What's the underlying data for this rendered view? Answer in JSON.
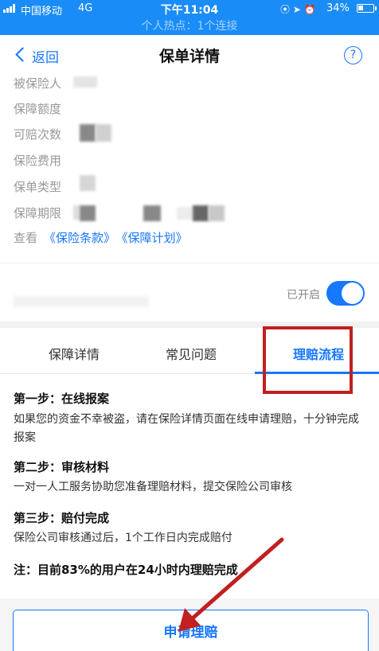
{
  "status_bar": {
    "carrier": "中国移动",
    "network": "4G",
    "time": "下午11:04",
    "battery": "34%",
    "battery_level": 0.34,
    "hotspot": "个人热点：1个连接"
  },
  "header": {
    "back_label": "返回",
    "title": "保单详情",
    "help_glyph": "?"
  },
  "policy_info": {
    "rows": [
      {
        "label": "被保险人"
      },
      {
        "label": "保障额度"
      },
      {
        "label": "可赔次数"
      },
      {
        "label": "保险费用"
      },
      {
        "label": "保单类型"
      },
      {
        "label": "保障期限"
      }
    ],
    "view_prefix": "查看",
    "terms_link": "《保险条款》",
    "plan_link": "《保障计划》"
  },
  "toggle": {
    "label": "已开启",
    "enabled": true
  },
  "tabs": [
    {
      "label": "保障详情"
    },
    {
      "label": "常见问题"
    },
    {
      "label": "理赔流程",
      "active": true
    }
  ],
  "steps": [
    {
      "title": "第一步：在线报案",
      "desc": "如果您的资金不幸被盗，请在保险详情页面在线申请理赔，十分钟完成报案"
    },
    {
      "title": "第二步：审核材料",
      "desc": "一对一人工服务协助您准备理赔材料，提交保险公司审核"
    },
    {
      "title": "第三步：赔付完成",
      "desc": "保险公司审核通过后，1个工作日内完成赔付"
    }
  ],
  "note": "注：目前83%的用户在24小时内理赔完成",
  "apply_button": "申请理赔",
  "colors": {
    "accent": "#1677ff",
    "status_bar": "#1a8cf7",
    "annotation": "#c0201f"
  }
}
